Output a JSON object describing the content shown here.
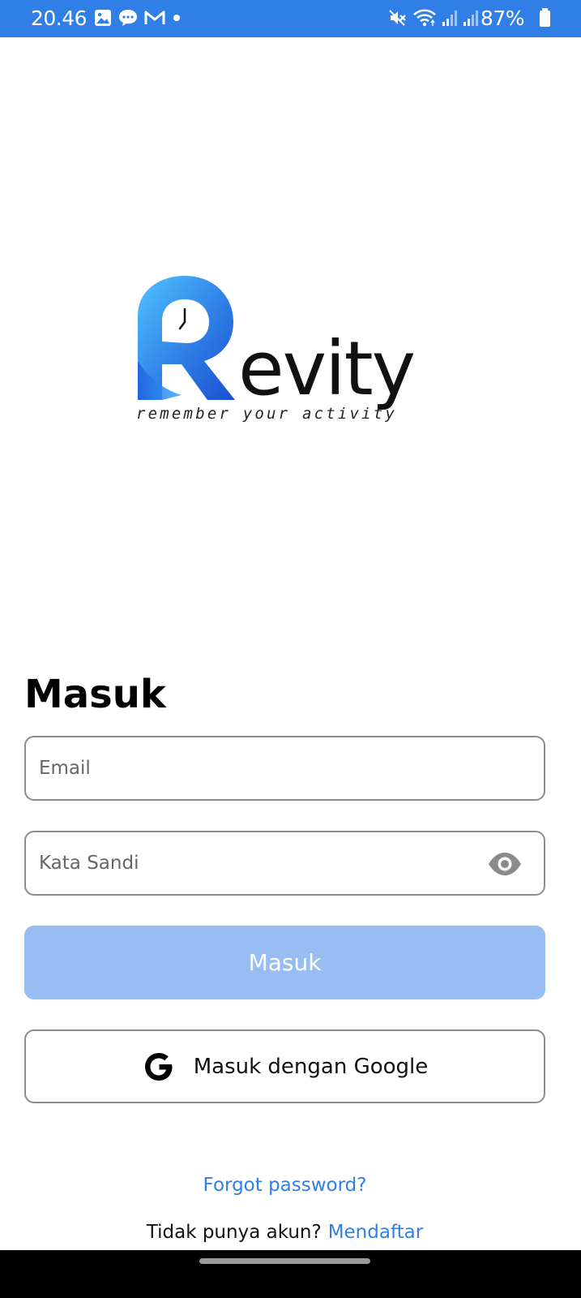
{
  "status_bar": {
    "time": "20.46",
    "battery": "87%",
    "icons_left": [
      "gallery-icon",
      "message-icon",
      "gmail-icon",
      "dot-icon"
    ],
    "icons_right": [
      "mute-icon",
      "wifi-icon",
      "signal-icon",
      "signal-icon"
    ],
    "background_color": "#2f7fe6"
  },
  "logo": {
    "wordmark": "evity",
    "tagline": "remember your activity",
    "accent_color": "#2f7fe6"
  },
  "login": {
    "title": "Masuk",
    "email_placeholder": "Email",
    "password_placeholder": "Kata Sandi",
    "submit_label": "Masuk",
    "google_label": "Masuk dengan Google",
    "forgot_label": "Forgot password?",
    "signup_prompt": "Tidak punya akun?",
    "signup_link": "Mendaftar"
  },
  "colors": {
    "primary_disabled": "#98bdf2",
    "link": "#2f7fe6",
    "border": "#8c8c94"
  }
}
